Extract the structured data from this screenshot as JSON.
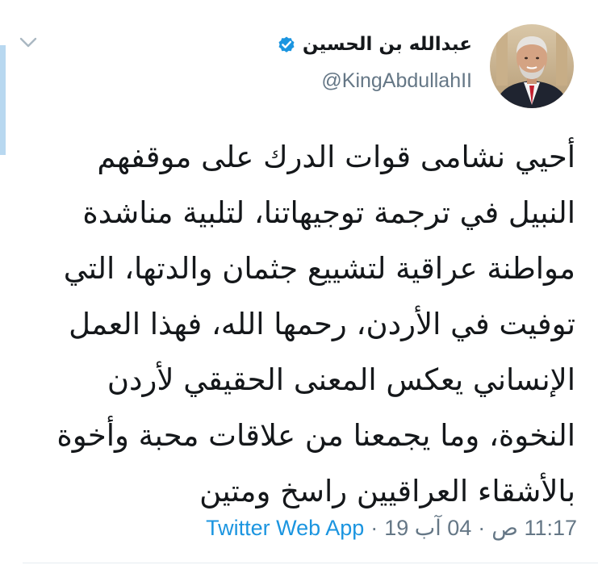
{
  "tweet": {
    "display_name": "عبدالله بن الحسين",
    "handle": "@KingAbdullahII",
    "verified": true,
    "text_lines": [
      "أحيي نشامى قوات الدرك على موقفهم",
      "النبيل في ترجمة توجيهاتنا، لتلبية مناشدة",
      "مواطنة عراقية لتشييع جثمان والدتها، التي",
      "توفيت في الأردن، رحمها الله، فهذا العمل",
      "الإنساني يعكس المعنى الحقيقي لأردن",
      "النخوة، وما يجمعنا من علاقات محبة وأخوة",
      "بالأشقاء العراقيين راسخ ومتين"
    ],
    "time": "11:17 ص",
    "date": "04 آب 19",
    "separator": "·",
    "source": "Twitter Web App"
  },
  "icons": {
    "verified_badge": "verified-check-icon",
    "menu_chevron": "chevron-down-icon"
  },
  "colors": {
    "accent_blue": "#1b95e0",
    "muted_text": "#657786",
    "primary_text": "#14171a",
    "left_highlight": "#b8d8f0"
  }
}
